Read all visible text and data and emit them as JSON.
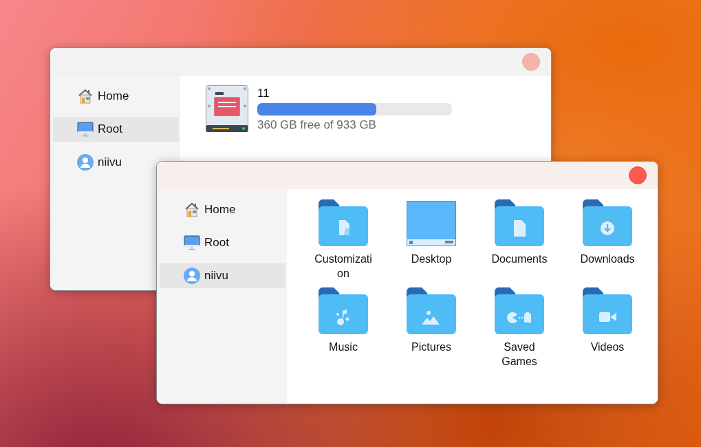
{
  "windows": [
    {
      "active": false,
      "sidebar": {
        "items": [
          {
            "label": "Home",
            "kind": "home",
            "selected": false
          },
          {
            "label": "Root",
            "kind": "computer",
            "selected": true
          },
          {
            "label": "niivu",
            "kind": "user",
            "selected": false
          }
        ]
      },
      "drives": [
        {
          "name": "11",
          "level": 0.61,
          "reading": "360 GB free of 933 GB"
        }
      ]
    },
    {
      "active": true,
      "sidebar": {
        "items": [
          {
            "label": "Home",
            "kind": "home",
            "selected": false
          },
          {
            "label": "Root",
            "kind": "computer",
            "selected": false
          },
          {
            "label": "niivu",
            "kind": "user",
            "selected": true
          }
        ]
      },
      "folders": [
        {
          "label": "Customization",
          "kind": "customization"
        },
        {
          "label": "Desktop",
          "kind": "desktop"
        },
        {
          "label": "Documents",
          "kind": "documents"
        },
        {
          "label": "Downloads",
          "kind": "downloads"
        },
        {
          "label": "Music",
          "kind": "music"
        },
        {
          "label": "Pictures",
          "kind": "pictures"
        },
        {
          "label": "Saved Games",
          "kind": "games"
        },
        {
          "label": "Videos",
          "kind": "videos"
        }
      ]
    }
  ]
}
